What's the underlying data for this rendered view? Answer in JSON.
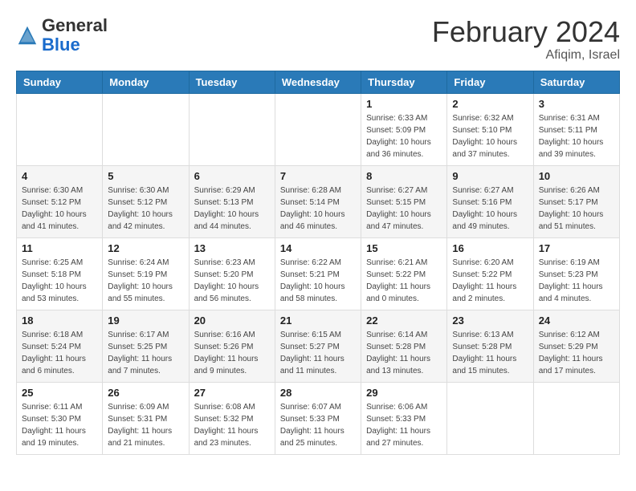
{
  "header": {
    "logo_general": "General",
    "logo_blue": "Blue",
    "month_title": "February 2024",
    "location": "Afiqim, Israel"
  },
  "weekdays": [
    "Sunday",
    "Monday",
    "Tuesday",
    "Wednesday",
    "Thursday",
    "Friday",
    "Saturday"
  ],
  "weeks": [
    [
      {
        "day": "",
        "info": ""
      },
      {
        "day": "",
        "info": ""
      },
      {
        "day": "",
        "info": ""
      },
      {
        "day": "",
        "info": ""
      },
      {
        "day": "1",
        "info": "Sunrise: 6:33 AM\nSunset: 5:09 PM\nDaylight: 10 hours\nand 36 minutes."
      },
      {
        "day": "2",
        "info": "Sunrise: 6:32 AM\nSunset: 5:10 PM\nDaylight: 10 hours\nand 37 minutes."
      },
      {
        "day": "3",
        "info": "Sunrise: 6:31 AM\nSunset: 5:11 PM\nDaylight: 10 hours\nand 39 minutes."
      }
    ],
    [
      {
        "day": "4",
        "info": "Sunrise: 6:30 AM\nSunset: 5:12 PM\nDaylight: 10 hours\nand 41 minutes."
      },
      {
        "day": "5",
        "info": "Sunrise: 6:30 AM\nSunset: 5:12 PM\nDaylight: 10 hours\nand 42 minutes."
      },
      {
        "day": "6",
        "info": "Sunrise: 6:29 AM\nSunset: 5:13 PM\nDaylight: 10 hours\nand 44 minutes."
      },
      {
        "day": "7",
        "info": "Sunrise: 6:28 AM\nSunset: 5:14 PM\nDaylight: 10 hours\nand 46 minutes."
      },
      {
        "day": "8",
        "info": "Sunrise: 6:27 AM\nSunset: 5:15 PM\nDaylight: 10 hours\nand 47 minutes."
      },
      {
        "day": "9",
        "info": "Sunrise: 6:27 AM\nSunset: 5:16 PM\nDaylight: 10 hours\nand 49 minutes."
      },
      {
        "day": "10",
        "info": "Sunrise: 6:26 AM\nSunset: 5:17 PM\nDaylight: 10 hours\nand 51 minutes."
      }
    ],
    [
      {
        "day": "11",
        "info": "Sunrise: 6:25 AM\nSunset: 5:18 PM\nDaylight: 10 hours\nand 53 minutes."
      },
      {
        "day": "12",
        "info": "Sunrise: 6:24 AM\nSunset: 5:19 PM\nDaylight: 10 hours\nand 55 minutes."
      },
      {
        "day": "13",
        "info": "Sunrise: 6:23 AM\nSunset: 5:20 PM\nDaylight: 10 hours\nand 56 minutes."
      },
      {
        "day": "14",
        "info": "Sunrise: 6:22 AM\nSunset: 5:21 PM\nDaylight: 10 hours\nand 58 minutes."
      },
      {
        "day": "15",
        "info": "Sunrise: 6:21 AM\nSunset: 5:22 PM\nDaylight: 11 hours\nand 0 minutes."
      },
      {
        "day": "16",
        "info": "Sunrise: 6:20 AM\nSunset: 5:22 PM\nDaylight: 11 hours\nand 2 minutes."
      },
      {
        "day": "17",
        "info": "Sunrise: 6:19 AM\nSunset: 5:23 PM\nDaylight: 11 hours\nand 4 minutes."
      }
    ],
    [
      {
        "day": "18",
        "info": "Sunrise: 6:18 AM\nSunset: 5:24 PM\nDaylight: 11 hours\nand 6 minutes."
      },
      {
        "day": "19",
        "info": "Sunrise: 6:17 AM\nSunset: 5:25 PM\nDaylight: 11 hours\nand 7 minutes."
      },
      {
        "day": "20",
        "info": "Sunrise: 6:16 AM\nSunset: 5:26 PM\nDaylight: 11 hours\nand 9 minutes."
      },
      {
        "day": "21",
        "info": "Sunrise: 6:15 AM\nSunset: 5:27 PM\nDaylight: 11 hours\nand 11 minutes."
      },
      {
        "day": "22",
        "info": "Sunrise: 6:14 AM\nSunset: 5:28 PM\nDaylight: 11 hours\nand 13 minutes."
      },
      {
        "day": "23",
        "info": "Sunrise: 6:13 AM\nSunset: 5:28 PM\nDaylight: 11 hours\nand 15 minutes."
      },
      {
        "day": "24",
        "info": "Sunrise: 6:12 AM\nSunset: 5:29 PM\nDaylight: 11 hours\nand 17 minutes."
      }
    ],
    [
      {
        "day": "25",
        "info": "Sunrise: 6:11 AM\nSunset: 5:30 PM\nDaylight: 11 hours\nand 19 minutes."
      },
      {
        "day": "26",
        "info": "Sunrise: 6:09 AM\nSunset: 5:31 PM\nDaylight: 11 hours\nand 21 minutes."
      },
      {
        "day": "27",
        "info": "Sunrise: 6:08 AM\nSunset: 5:32 PM\nDaylight: 11 hours\nand 23 minutes."
      },
      {
        "day": "28",
        "info": "Sunrise: 6:07 AM\nSunset: 5:33 PM\nDaylight: 11 hours\nand 25 minutes."
      },
      {
        "day": "29",
        "info": "Sunrise: 6:06 AM\nSunset: 5:33 PM\nDaylight: 11 hours\nand 27 minutes."
      },
      {
        "day": "",
        "info": ""
      },
      {
        "day": "",
        "info": ""
      }
    ]
  ]
}
